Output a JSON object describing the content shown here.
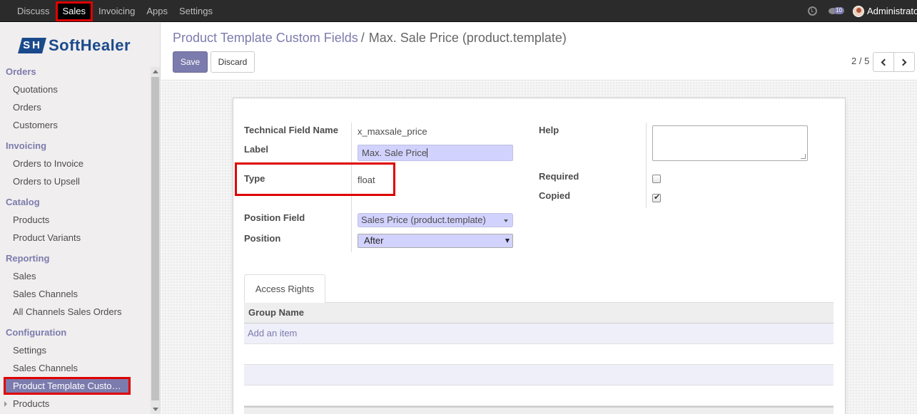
{
  "topbar": {
    "menu": [
      "Discuss",
      "Sales",
      "Invoicing",
      "Apps",
      "Settings"
    ],
    "active": "Sales",
    "message_count": "10",
    "username": "Administrator"
  },
  "sidebar": {
    "logo": "SoftHealer",
    "sections": [
      {
        "title": "Orders",
        "items": [
          "Quotations",
          "Orders",
          "Customers"
        ]
      },
      {
        "title": "Invoicing",
        "items": [
          "Orders to Invoice",
          "Orders to Upsell"
        ]
      },
      {
        "title": "Catalog",
        "items": [
          "Products",
          "Product Variants"
        ]
      },
      {
        "title": "Reporting",
        "items": [
          "Sales",
          "Sales Channels",
          "All Channels Sales Orders"
        ]
      },
      {
        "title": "Configuration",
        "items": [
          "Settings",
          "Sales Channels",
          "Product Template Custo…",
          "Products"
        ]
      }
    ]
  },
  "control": {
    "breadcrumb_parent": "Product Template Custom Fields",
    "breadcrumb_sep": "/",
    "breadcrumb_current": "Max. Sale Price (product.template)",
    "save_label": "Save",
    "discard_label": "Discard",
    "pager": "2 / 5"
  },
  "form": {
    "technical_field_label": "Technical Field Name",
    "technical_field_value": "x_maxsale_price",
    "label_label": "Label",
    "label_value": "Max. Sale Price",
    "type_label": "Type",
    "type_value": "float",
    "position_field_label": "Position Field",
    "position_field_value": "Sales Price (product.template)",
    "position_label": "Position",
    "position_value": "After",
    "help_label": "Help",
    "required_label": "Required",
    "required_checked": false,
    "copied_label": "Copied",
    "copied_checked": true
  },
  "tabs": {
    "access_rights": "Access Rights",
    "group_name_header": "Group Name",
    "add_item": "Add an item"
  },
  "colors": {
    "accent": "#7c7bad",
    "highlight": "#e00000",
    "input_bg": "#d2d2ff",
    "navbar": "#2b2b2b"
  }
}
